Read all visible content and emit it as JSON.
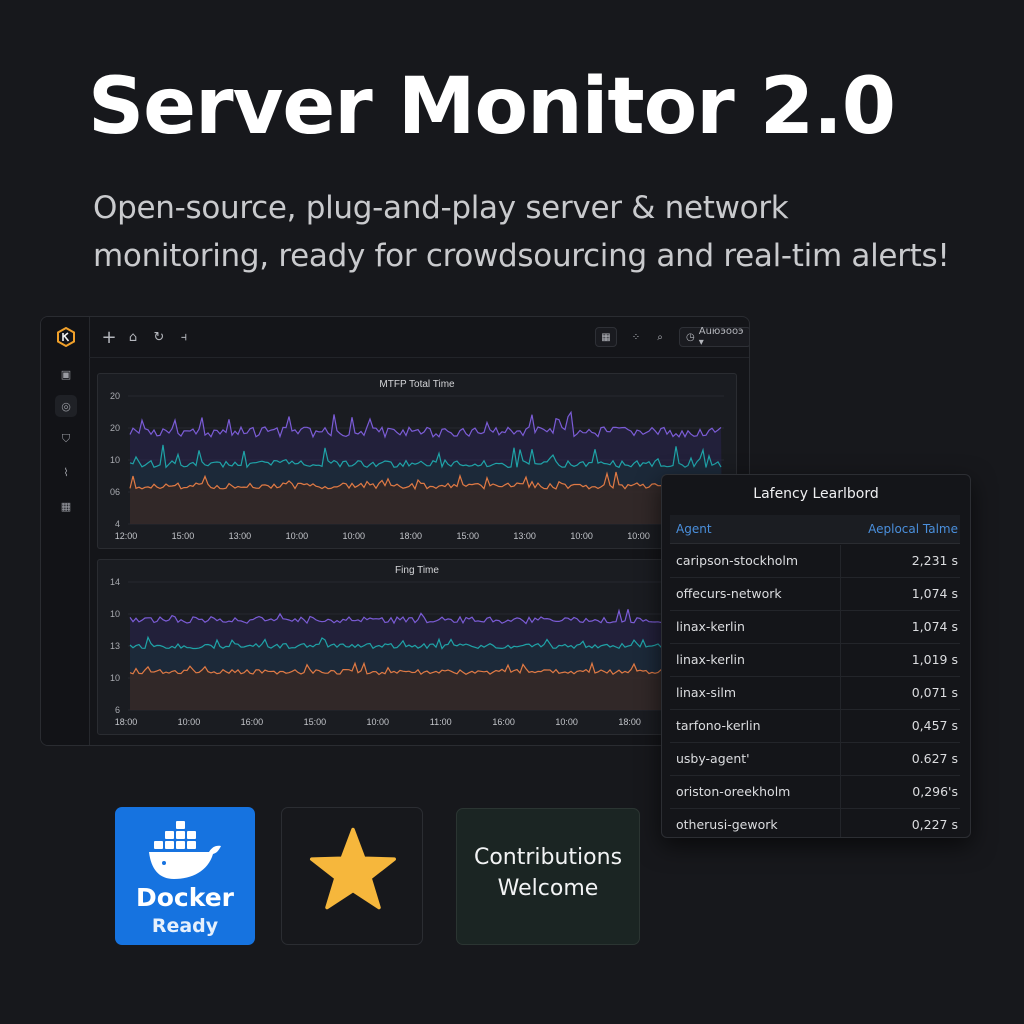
{
  "hero": {
    "title": "Server Monitor 2.0",
    "subtitle_line1": "Open-source, plug-and-play server & network",
    "subtitle_line2": "monitoring, ready for crowdsourcing and real-tim alerts!"
  },
  "dashboard": {
    "sidebar_icons": [
      "logo-icon",
      "dashboard-icon",
      "globe-icon",
      "shield-icon",
      "activity-icon",
      "grid-icon"
    ],
    "toolbar": {
      "time_picker_label": "Auюэооэ ▾"
    },
    "panels": [
      {
        "title": "MTFP Total Time",
        "y_ticks": [
          "20",
          "20",
          "10",
          "06",
          "4"
        ],
        "x_ticks": [
          "12:00",
          "15:00",
          "13:00",
          "10:00",
          "10:00",
          "18:00",
          "15:00",
          "13:00",
          "10:00",
          "10:00",
          "10:00"
        ],
        "series_colors": [
          "#7b5cd6",
          "#1fa3a8",
          "#e07a45"
        ]
      },
      {
        "title": "Fing Time",
        "y_ticks": [
          "14",
          "10",
          "13",
          "10",
          "6"
        ],
        "x_ticks": [
          "18:00",
          "10:00",
          "16:00",
          "15:00",
          "10:00",
          "11:00",
          "16:00",
          "10:00",
          "18:00",
          "10:00"
        ],
        "series_colors": [
          "#7b5cd6",
          "#1fa3a8",
          "#e07a45"
        ]
      }
    ]
  },
  "leaderboard": {
    "title": "Lafency Learlbord",
    "col_agent": "Agent",
    "col_value": "Aeplocal Talme",
    "rows": [
      {
        "agent": "caripson-stockholm",
        "value": "2,231 s"
      },
      {
        "agent": "offecurs-network",
        "value": "1,074 s"
      },
      {
        "agent": "linax-kerlin",
        "value": "1,074 s"
      },
      {
        "agent": "linax-kerlin",
        "value": "1,019 s"
      },
      {
        "agent": "linax-silm",
        "value": "0,071 s"
      },
      {
        "agent": "tarfono-kerlin",
        "value": "0,457 s"
      },
      {
        "agent": "usby-agent'",
        "value": "0.627 s"
      },
      {
        "agent": "oriston-oreekholm",
        "value": "0,296's"
      },
      {
        "agent": "otherusi-gework",
        "value": "0,227 s"
      }
    ]
  },
  "badges": {
    "docker_name": "Docker",
    "docker_sub": "Ready",
    "contrib_line1": "Contributions",
    "contrib_line2": "Welcome",
    "docker_color": "#1673e0",
    "star_color": "#f6b73c"
  }
}
